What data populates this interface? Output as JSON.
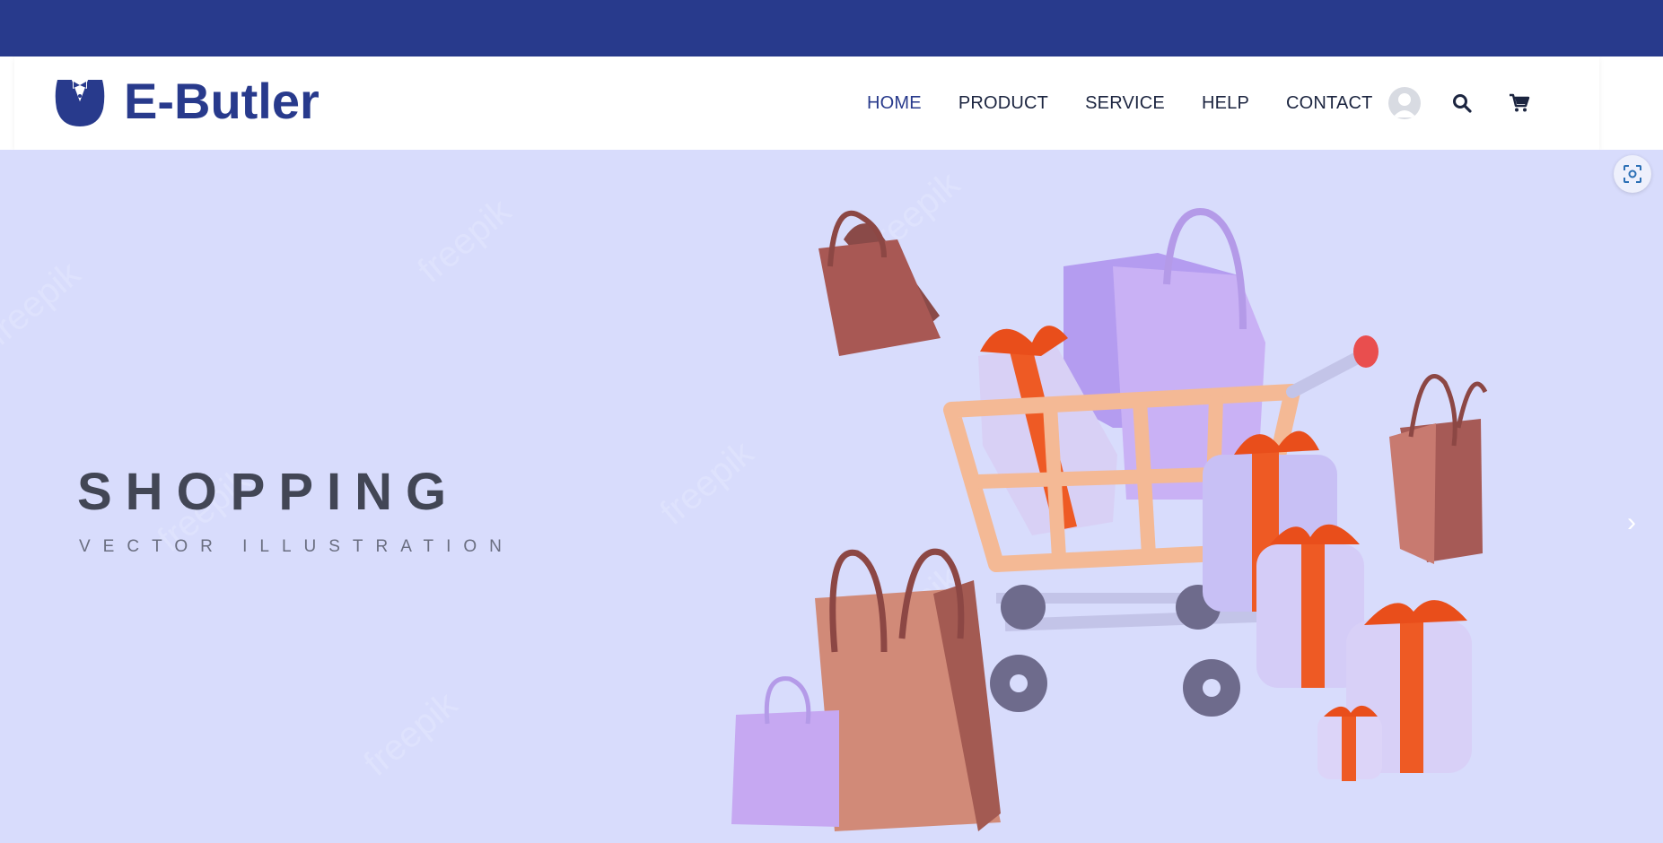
{
  "brand": {
    "name": "E-Butler",
    "colors": {
      "primary": "#283a8c",
      "hero_bg": "#d8dcfc",
      "text_dark": "#1c2540"
    }
  },
  "nav": {
    "items": [
      {
        "label": "HOME",
        "active": true
      },
      {
        "label": "PRODUCT",
        "active": false
      },
      {
        "label": "SERVICE",
        "active": false
      },
      {
        "label": "HELP",
        "active": false
      },
      {
        "label": "CONTACT",
        "active": false
      }
    ],
    "icons": [
      "user-avatar",
      "search-icon",
      "cart-icon"
    ]
  },
  "hero": {
    "title": "SHOPPING",
    "subtitle": "VECTOR ILLUSTRATION",
    "watermark": "freepik",
    "controls": {
      "scan_icon": "scan-icon",
      "next_icon": "chevron-right-icon",
      "next_glyph": "›"
    }
  }
}
